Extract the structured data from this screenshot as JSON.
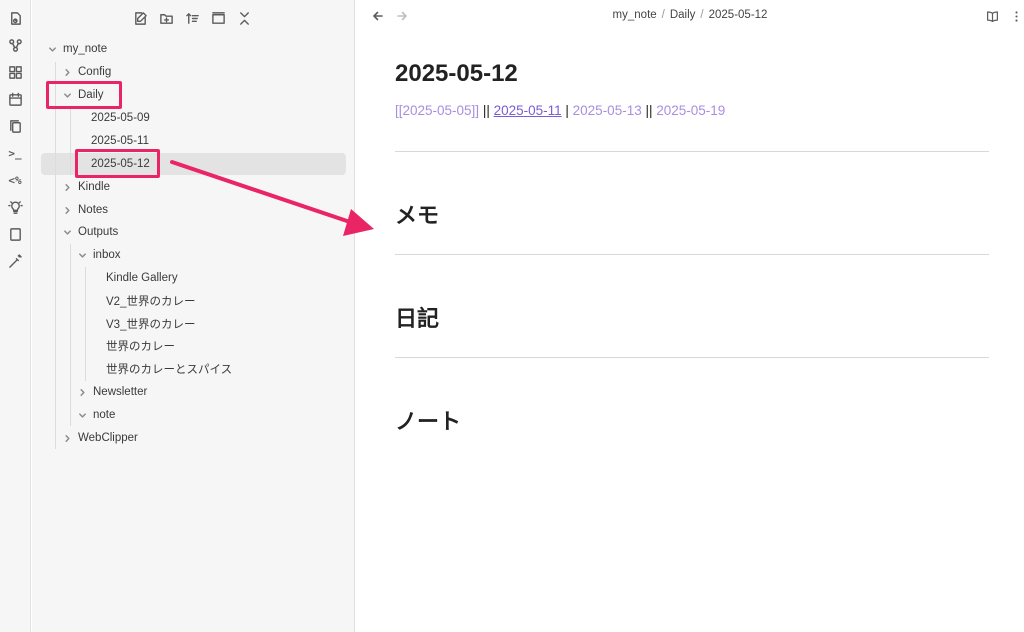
{
  "ribbon": {
    "icons": [
      "open-quick-switcher-icon",
      "graph-view-icon",
      "canvas-icon",
      "calendar-icon",
      "copy-icon",
      "terminal-icon",
      "templater-icon",
      "lightbulb-icon",
      "tablet-icon",
      "magic-wand-icon"
    ],
    "templater_text": "<%",
    "terminal_text": ">_"
  },
  "sidebar": {
    "toolbar_icons": [
      "new-note-icon",
      "new-folder-icon",
      "sort-icon",
      "collapse-view-icon",
      "collapse-all-icon"
    ],
    "root": "my_note",
    "items": [
      {
        "label": "Config",
        "type": "folder",
        "state": "collapsed"
      },
      {
        "label": "Daily",
        "type": "folder",
        "state": "expanded"
      },
      {
        "label": "2025-05-09",
        "type": "file"
      },
      {
        "label": "2025-05-11",
        "type": "file"
      },
      {
        "label": "2025-05-12",
        "type": "file",
        "selected": true
      },
      {
        "label": "Kindle",
        "type": "folder",
        "state": "collapsed"
      },
      {
        "label": "Notes",
        "type": "folder",
        "state": "collapsed"
      },
      {
        "label": "Outputs",
        "type": "folder",
        "state": "expanded"
      },
      {
        "label": "inbox",
        "type": "folder",
        "state": "expanded"
      },
      {
        "label": "Kindle Gallery",
        "type": "file"
      },
      {
        "label": "V2_世界のカレー",
        "type": "file"
      },
      {
        "label": "V3_世界のカレー",
        "type": "file"
      },
      {
        "label": "世界のカレー",
        "type": "file"
      },
      {
        "label": "世界のカレーとスパイス",
        "type": "file"
      },
      {
        "label": "Newsletter",
        "type": "folder",
        "state": "collapsed"
      },
      {
        "label": "note",
        "type": "folder",
        "state": "expanded"
      },
      {
        "label": "WebClipper",
        "type": "folder",
        "state": "collapsed"
      }
    ]
  },
  "header": {
    "breadcrumb": [
      "my_note",
      "Daily",
      "2025-05-12"
    ],
    "separator": "/"
  },
  "document": {
    "title": "2025-05-12",
    "nav_links": {
      "prev_prev": "[[2025-05-05]]",
      "sep1": " || ",
      "prev": "2025-05-11",
      "sep2": " | ",
      "next": "2025-05-13",
      "sep3": " || ",
      "next_next": "2025-05-19"
    },
    "sections": [
      "メモ",
      "日記",
      "ノート"
    ]
  },
  "annotation": {
    "highlight_color": "#ea2566"
  }
}
